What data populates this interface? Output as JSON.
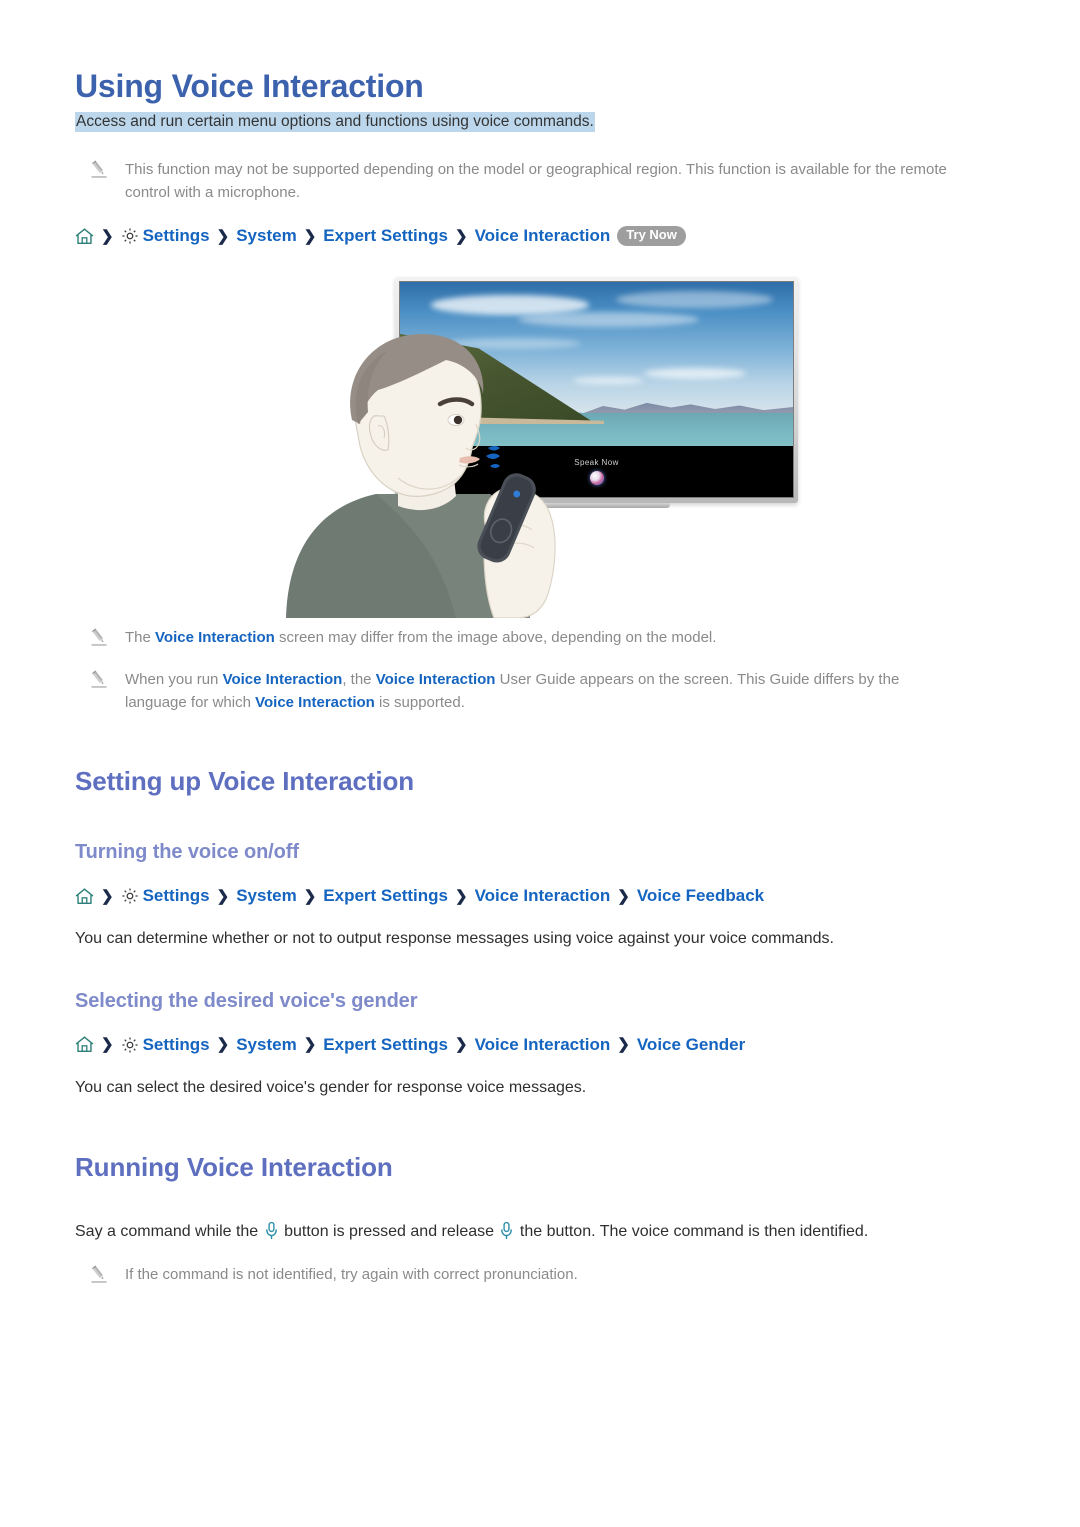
{
  "document": {
    "title": "Using Voice Interaction",
    "subtitle": "Access and run certain menu options and functions using voice commands.",
    "note_top": {
      "text": "This function may not be supported depending on the model or geographical region. This function is available for the remote control with a microphone.",
      "icon": "pencil-icon"
    },
    "breadcrumb_main": {
      "home_icon": "home-icon",
      "gear_icon": "gear-icon",
      "chevron": "❯",
      "items": [
        "Settings",
        "System",
        "Expert Settings",
        "Voice Interaction"
      ],
      "badge": "Try Now"
    },
    "illustration": {
      "alt": "Man speaking into remote control microphone facing a TV",
      "tv_screen_label": "Speak Now",
      "orb_icon": "voice-orb-icon"
    },
    "note_image_1": {
      "prefix": "The ",
      "link": "Voice Interaction",
      "suffix": " screen may differ from the image above, depending on the model."
    },
    "note_image_2": {
      "p1": "When you run ",
      "l1": "Voice Interaction",
      "p2": ", the ",
      "l2": "Voice Interaction",
      "p3": " User Guide appears on the screen. This Guide differs by the language for which ",
      "l3": "Voice Interaction",
      "p4": " is supported."
    },
    "sections": [
      {
        "heading": "Setting up Voice Interaction",
        "subsections": [
          {
            "heading": "Turning the voice on/off",
            "breadcrumb": [
              "Settings",
              "System",
              "Expert Settings",
              "Voice Interaction",
              "Voice Feedback"
            ],
            "body": "You can determine whether or not to output response messages using voice against your voice commands."
          },
          {
            "heading": "Selecting the desired voice's gender",
            "breadcrumb": [
              "Settings",
              "System",
              "Expert Settings",
              "Voice Interaction",
              "Voice Gender"
            ],
            "body": "You can select the desired voice's gender for response voice messages."
          }
        ]
      },
      {
        "heading": "Running Voice Interaction",
        "body_part_1": "Say a command while the ",
        "body_part_2": " button is pressed and release ",
        "body_part_3": " the button. The voice command is then identified.",
        "mic_icon": "microphone-icon",
        "note": "If the command is not identified, try again with correct pronunciation."
      }
    ],
    "colors": {
      "title_blue": "#3d62ad",
      "section_blue": "#5e6fc0",
      "subsection_blue": "#7e8ac9",
      "link_blue": "#1565c0",
      "highlight_bg": "#bcd7ec",
      "note_gray": "#8a8a8a",
      "badge_gray": "#9e9e9e",
      "mic_teal": "#2b8fa8"
    }
  }
}
